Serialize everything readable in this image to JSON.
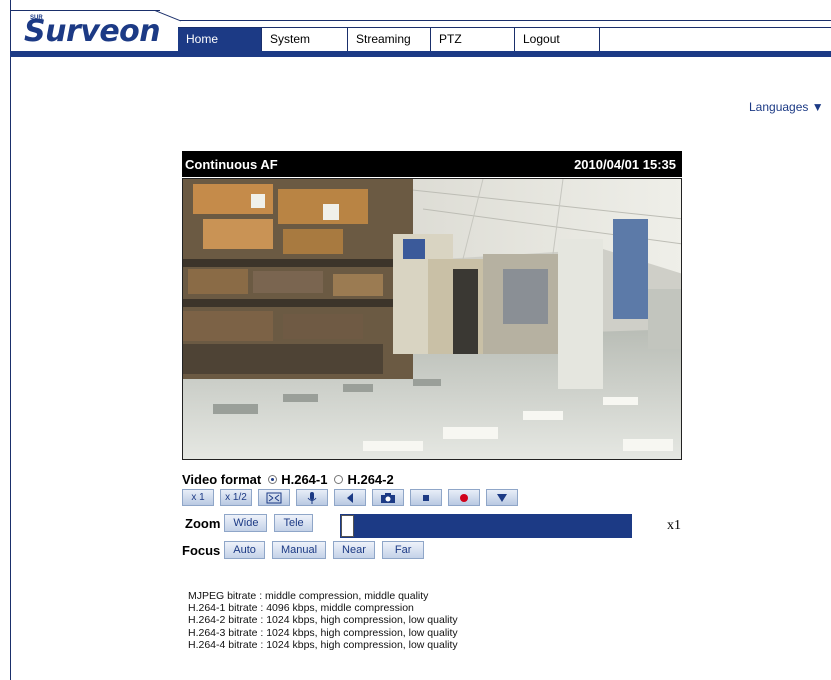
{
  "brand": {
    "logo_text": "Surveon",
    "logo_mark": "SUR"
  },
  "nav": {
    "items": [
      {
        "label": "Home",
        "active": true
      },
      {
        "label": "System",
        "active": false
      },
      {
        "label": "Streaming",
        "active": false
      },
      {
        "label": "PTZ",
        "active": false
      },
      {
        "label": "Logout",
        "active": false
      }
    ]
  },
  "languages": {
    "label": "Languages ▼"
  },
  "video": {
    "title": "Continuous AF",
    "datetime": "2010/04/01 15:35"
  },
  "video_format": {
    "label": "Video format",
    "options": [
      {
        "label": "H.264-1",
        "selected": true
      },
      {
        "label": "H.264-2",
        "selected": false
      }
    ]
  },
  "toolbar": {
    "x1": "x 1",
    "x12": "x 1/2",
    "fullscreen_icon": "fullscreen-icon",
    "mic_icon": "microphone-icon",
    "speaker_icon": "speaker-icon",
    "snapshot_icon": "camera-icon",
    "stop_icon": "stop-icon",
    "record_icon": "record-icon",
    "more_icon": "chevron-down-icon"
  },
  "zoom": {
    "label": "Zoom",
    "wide": "Wide",
    "tele": "Tele",
    "level": "x1",
    "track_fraction": 0.0
  },
  "focus": {
    "label": "Focus",
    "auto": "Auto",
    "manual": "Manual",
    "near": "Near",
    "far": "Far"
  },
  "bitrates": [
    "MJPEG bitrate : middle compression, middle quality",
    "H.264-1 bitrate : 4096 kbps, middle compression",
    "H.264-2 bitrate : 1024 kbps, high compression, low quality",
    "H.264-3 bitrate : 1024 kbps, high compression, low quality",
    "H.264-4 bitrate : 1024 kbps, high compression, low quality"
  ],
  "colors": {
    "brand_blue": "#1c3a85",
    "record_red": "#d0021b"
  }
}
